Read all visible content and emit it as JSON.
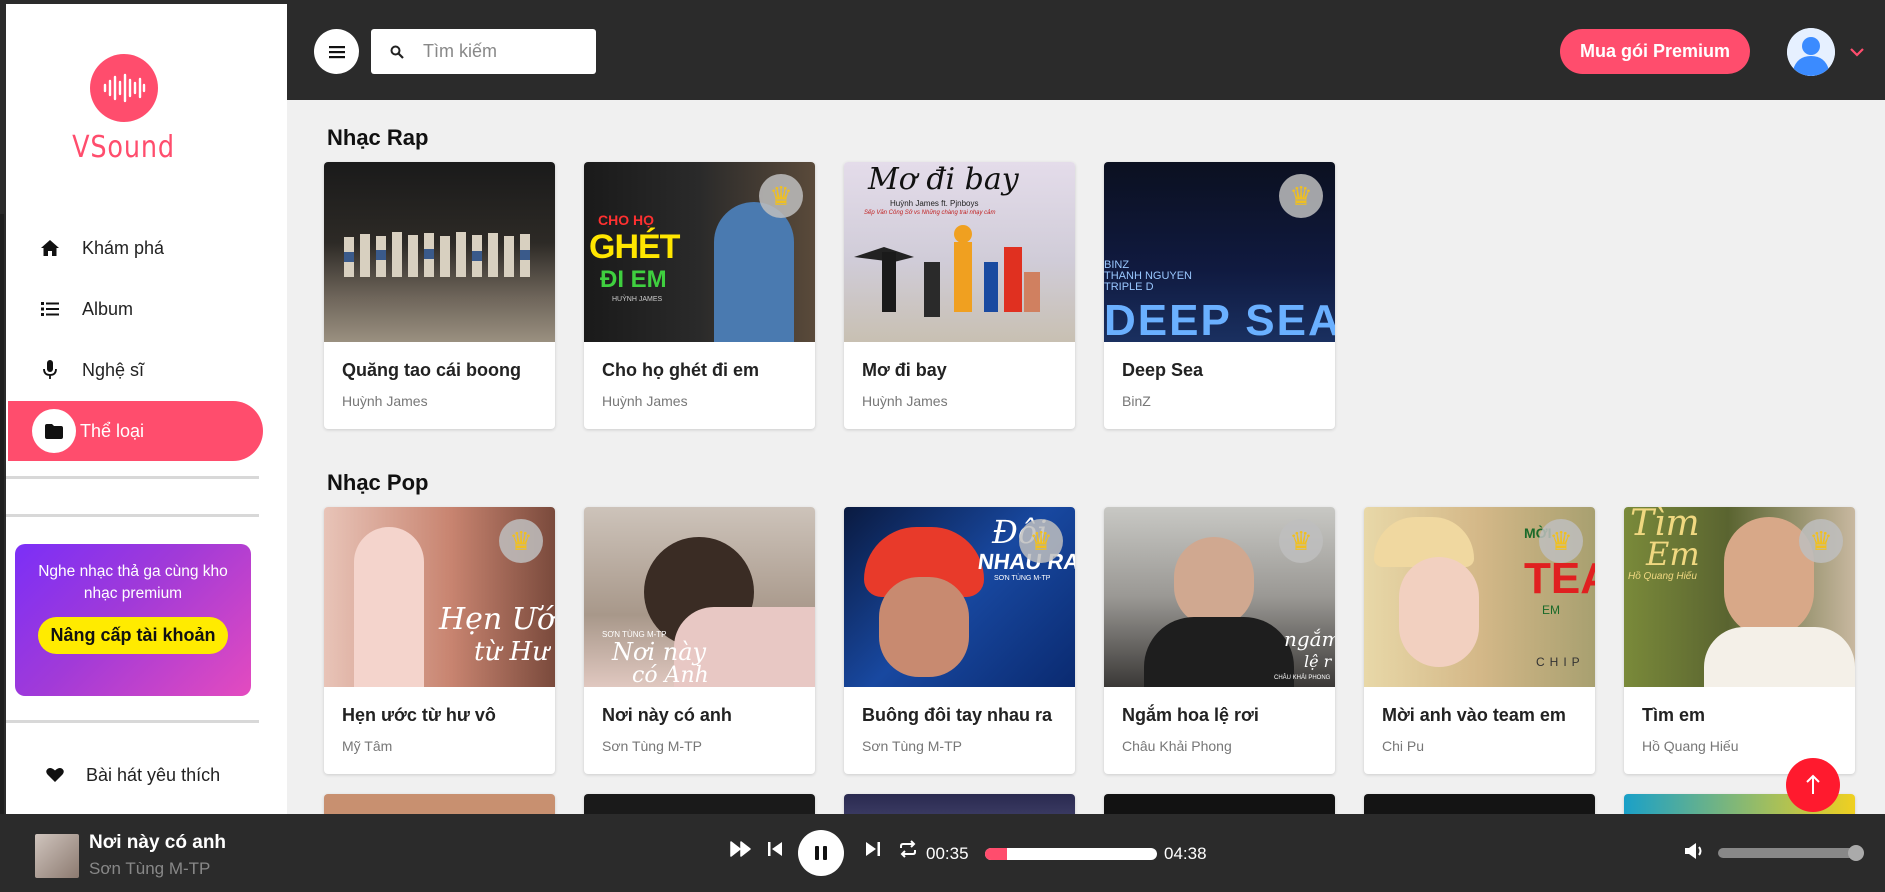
{
  "app": {
    "name": "VSound",
    "brand_color": "#ff4d6d"
  },
  "sidebar": {
    "items": [
      {
        "label": "Khám phá",
        "icon": "home-icon"
      },
      {
        "label": "Album",
        "icon": "list-icon"
      },
      {
        "label": "Nghệ sĩ",
        "icon": "microphone-icon"
      },
      {
        "label": "Thể loại",
        "icon": "folder-icon",
        "active": true
      }
    ],
    "promo": {
      "text": "Nghe nhạc thả ga cùng kho nhạc premium",
      "button": "Nâng cấp tài khoản"
    },
    "favorites_label": "Bài hát yêu thích"
  },
  "header": {
    "search_placeholder": "Tìm kiếm",
    "premium_button": "Mua gói Premium"
  },
  "sections": [
    {
      "title": "Nhạc Rap",
      "cards": [
        {
          "title": "Quăng tao cái boong",
          "artist": "Huỳnh James",
          "premium": false,
          "thumb_color": "#3a3530"
        },
        {
          "title": "Cho họ ghét đi em",
          "artist": "Huỳnh James",
          "premium": true,
          "thumb_color": "#1c1c1c",
          "thumb_text": [
            "CHO HỌ",
            "GHÉT",
            "ĐI EM",
            "HUỲNH JAMES"
          ]
        },
        {
          "title": "Mơ đi bay",
          "artist": "Huỳnh James",
          "premium": false,
          "thumb_color": "#d9d6e6",
          "thumb_text": [
            "Mơ đi bay",
            "Huỳnh James ft. Pjnboys",
            "Sếp Văn Công Sở vs Những chàng trai nhạy cảm"
          ]
        },
        {
          "title": "Deep Sea",
          "artist": "BinZ",
          "premium": true,
          "thumb_color": "#0d1a3a",
          "thumb_text": [
            "BINZ",
            "THANH NGUYEN",
            "TRIPLE D",
            "DEEP SEA"
          ]
        }
      ]
    },
    {
      "title": "Nhạc Pop",
      "cards": [
        {
          "title": "Hẹn ước từ hư vô",
          "artist": "Mỹ Tâm",
          "premium": true,
          "thumb_color": "#c7887a",
          "thumb_text": [
            "Hẹn Ước",
            "từ Hư"
          ]
        },
        {
          "title": "Nơi này có anh",
          "artist": "Sơn Tùng M-TP",
          "premium": false,
          "thumb_color": "#b7a89c",
          "thumb_text": [
            "SƠN TÙNG M-TP",
            "Nơi này",
            "có Anh"
          ]
        },
        {
          "title": "Buông đôi tay nhau ra",
          "artist": "Sơn Tùng M-TP",
          "premium": true,
          "thumb_color": "#1a3f8a",
          "thumb_text": [
            "Đôi",
            "NHAU RA",
            "SƠN TÙNG M-TP"
          ]
        },
        {
          "title": "Ngắm hoa lệ rơi",
          "artist": "Châu Khải Phong",
          "premium": true,
          "thumb_color": "#6a6560",
          "thumb_text": [
            "ngắm h",
            "lệ r",
            "CHÂU KHẢI PHONG"
          ]
        },
        {
          "title": "Mời anh vào team em",
          "artist": "Chi Pu",
          "premium": true,
          "thumb_color": "#d8c39a",
          "thumb_text": [
            "MỜI",
            "TEAM",
            "EM",
            "CHIP"
          ]
        },
        {
          "title": "Tìm em",
          "artist": "Hồ Quang Hiếu",
          "premium": true,
          "thumb_color": "#6b7a3a",
          "thumb_text": [
            "Tìm",
            "Em",
            "Hồ Quang Hiếu"
          ]
        }
      ]
    }
  ],
  "player": {
    "title": "Nơi này có anh",
    "artist": "Sơn Tùng M-TP",
    "current_time": "00:35",
    "duration": "04:38",
    "progress_percent": 12.6,
    "volume_percent": 100
  }
}
